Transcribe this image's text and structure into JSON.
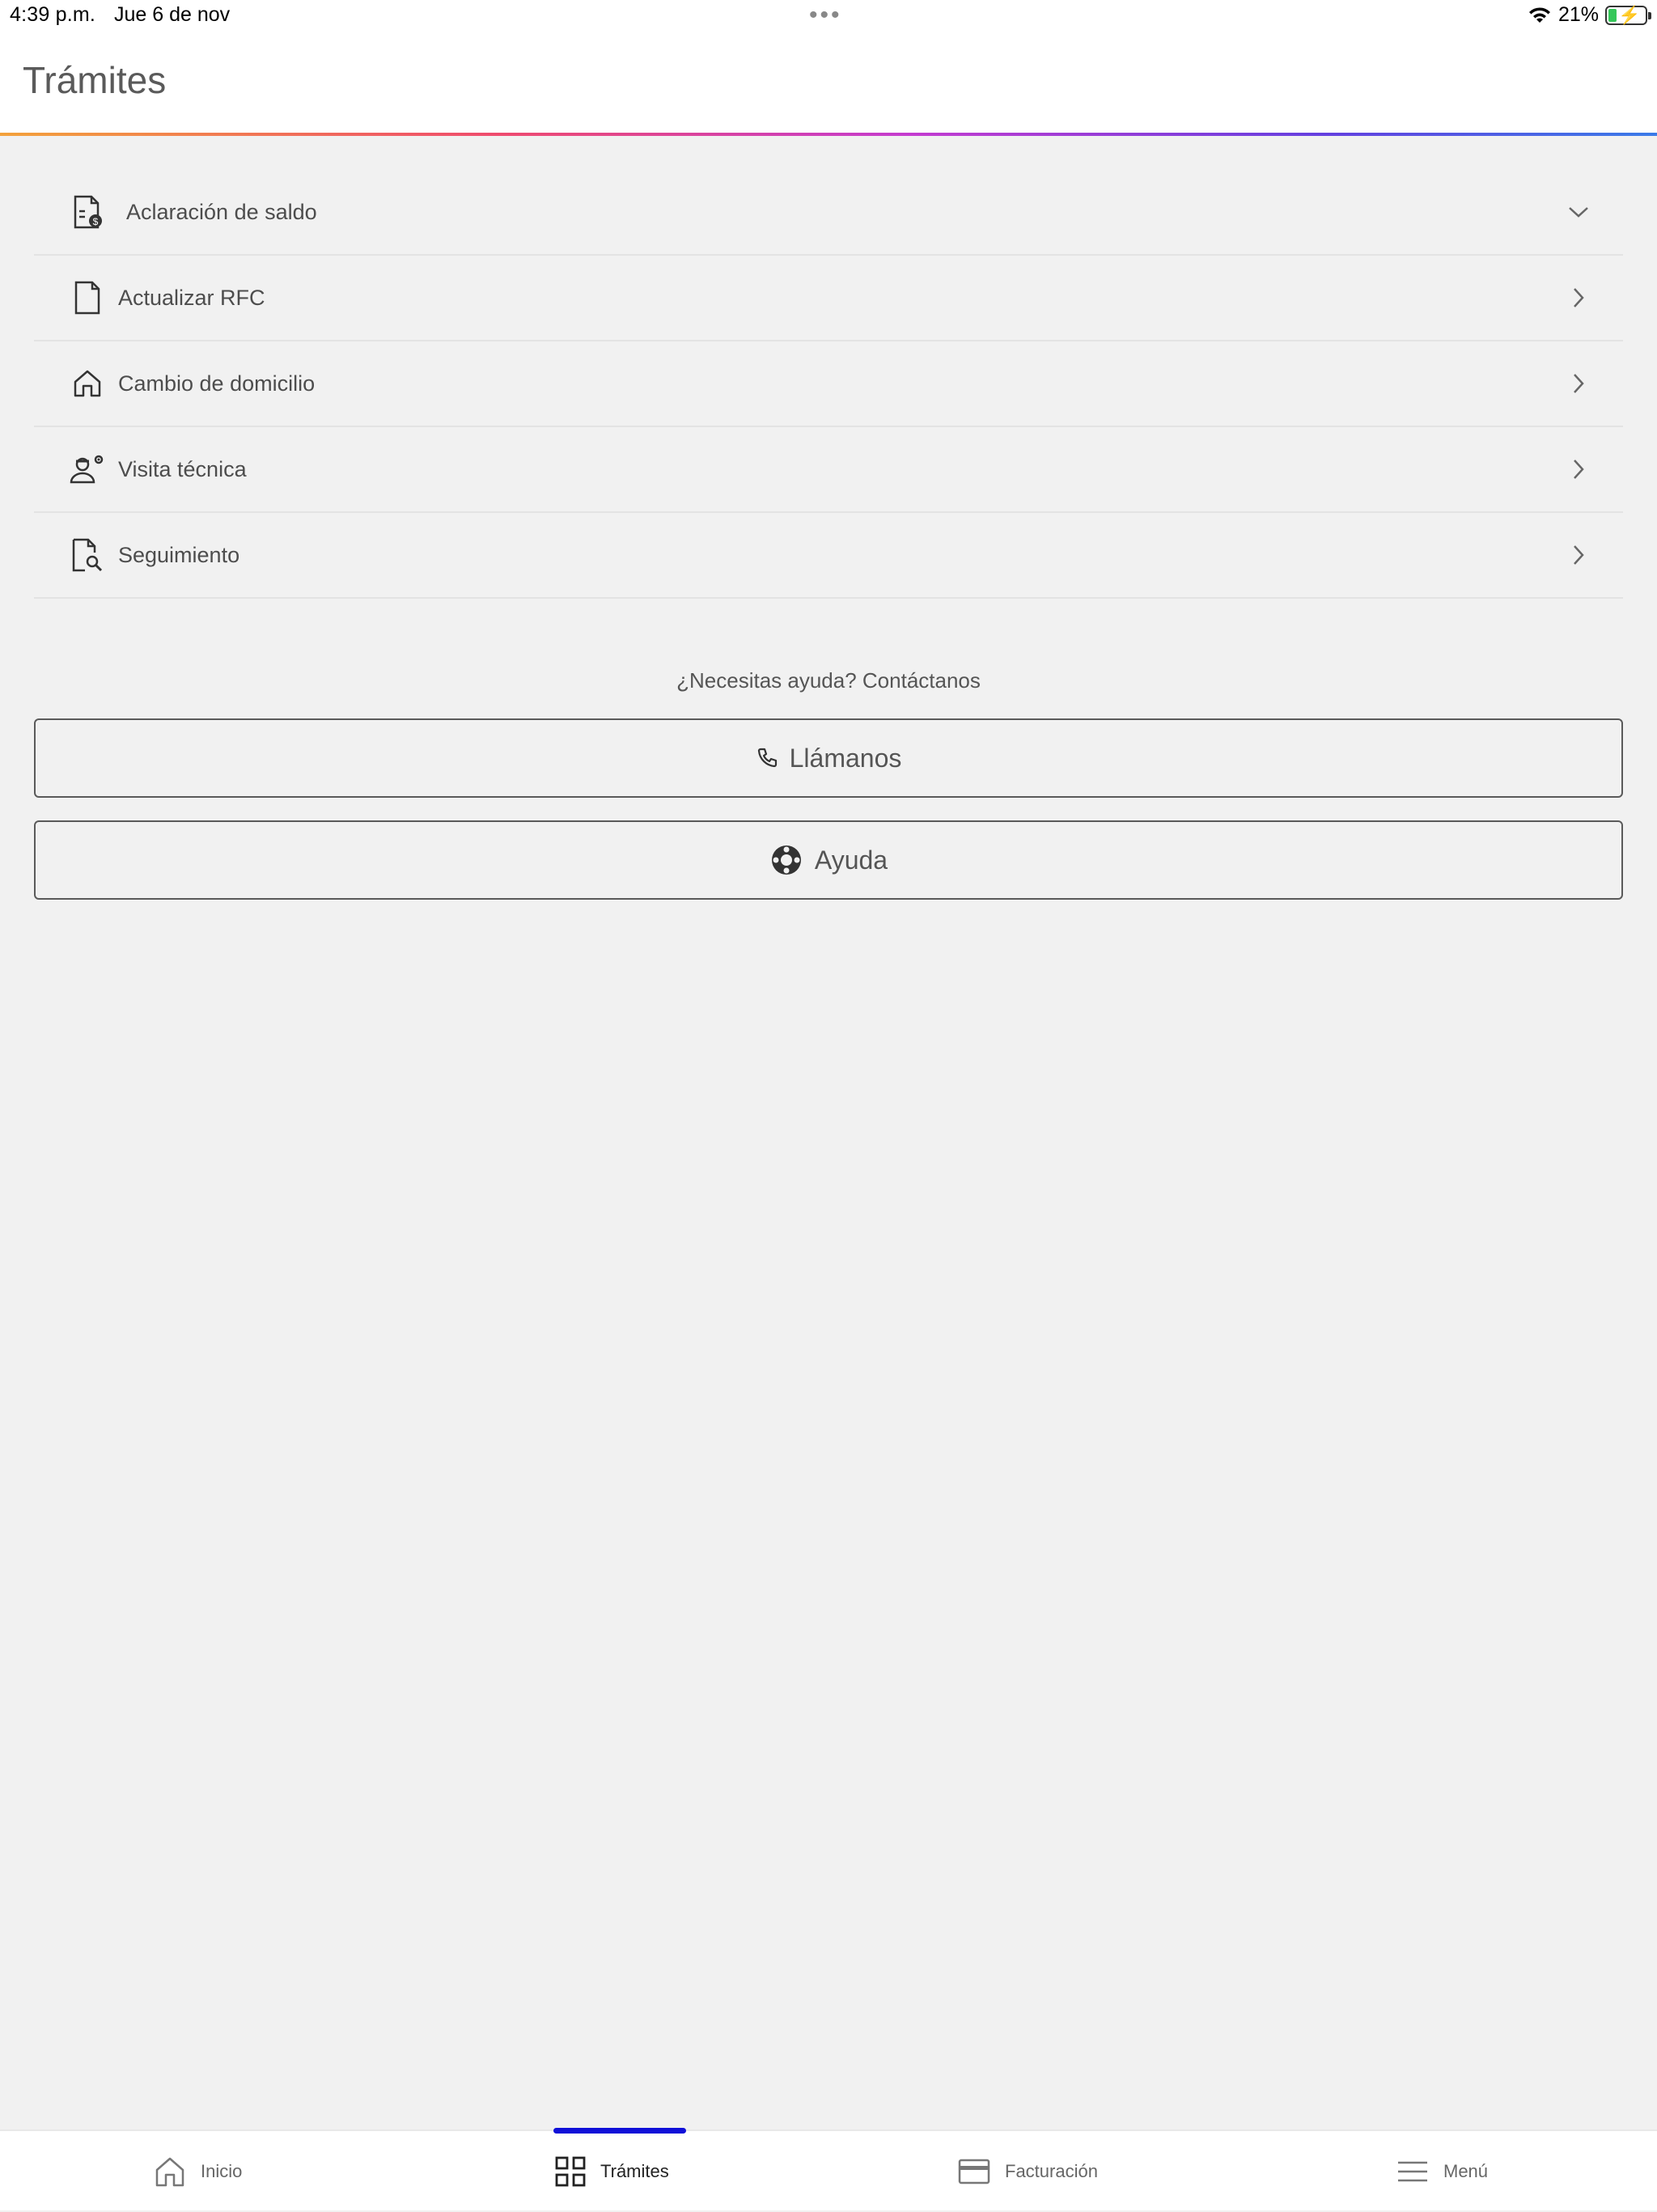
{
  "status_bar": {
    "time": "4:39 p.m.",
    "date": "Jue 6 de nov",
    "battery": "21%"
  },
  "header": {
    "title": "Trámites"
  },
  "items": [
    {
      "label": "Aclaración de saldo",
      "icon": "document-dollar-icon",
      "chevron": "chevron-down-icon"
    },
    {
      "label": "Actualizar RFC",
      "icon": "document-icon",
      "chevron": "chevron-right-icon"
    },
    {
      "label": "Cambio de domicilio",
      "icon": "house-icon",
      "chevron": "chevron-right-icon"
    },
    {
      "label": "Visita técnica",
      "icon": "technician-icon",
      "chevron": "chevron-right-icon"
    },
    {
      "label": "Seguimiento",
      "icon": "document-search-icon",
      "chevron": "chevron-right-icon"
    }
  ],
  "help": {
    "prompt": "¿Necesitas ayuda? Contáctanos",
    "call_label": "Llámanos",
    "help_label": "Ayuda"
  },
  "tabbar": {
    "tabs": [
      {
        "label": "Inicio",
        "icon": "home-icon"
      },
      {
        "label": "Trámites",
        "icon": "grid-icon",
        "active": true
      },
      {
        "label": "Facturación",
        "icon": "card-icon"
      },
      {
        "label": "Menú",
        "icon": "menu-icon"
      }
    ]
  },
  "colors": {
    "accent": "#1010d8",
    "background": "#f1f1f1",
    "text": "#4a4a4a"
  }
}
